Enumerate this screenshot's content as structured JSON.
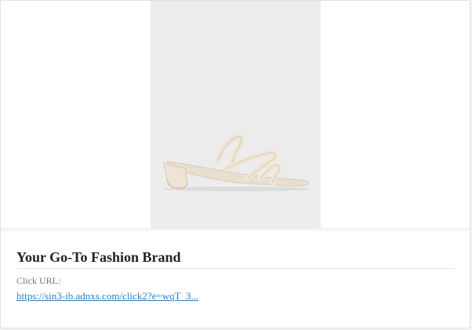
{
  "ad": {
    "brand_title": "Your Go-To Fashion Brand",
    "click_url_label": "Click URL:",
    "click_url": "https://sin3-ib.adnxs.com/click2?e=wqT_3...",
    "image_icon": "sandal-product-image"
  },
  "colors": {
    "image_background": "#ececec",
    "link": "#2a7fbf",
    "sandal": "#efe5d6"
  }
}
